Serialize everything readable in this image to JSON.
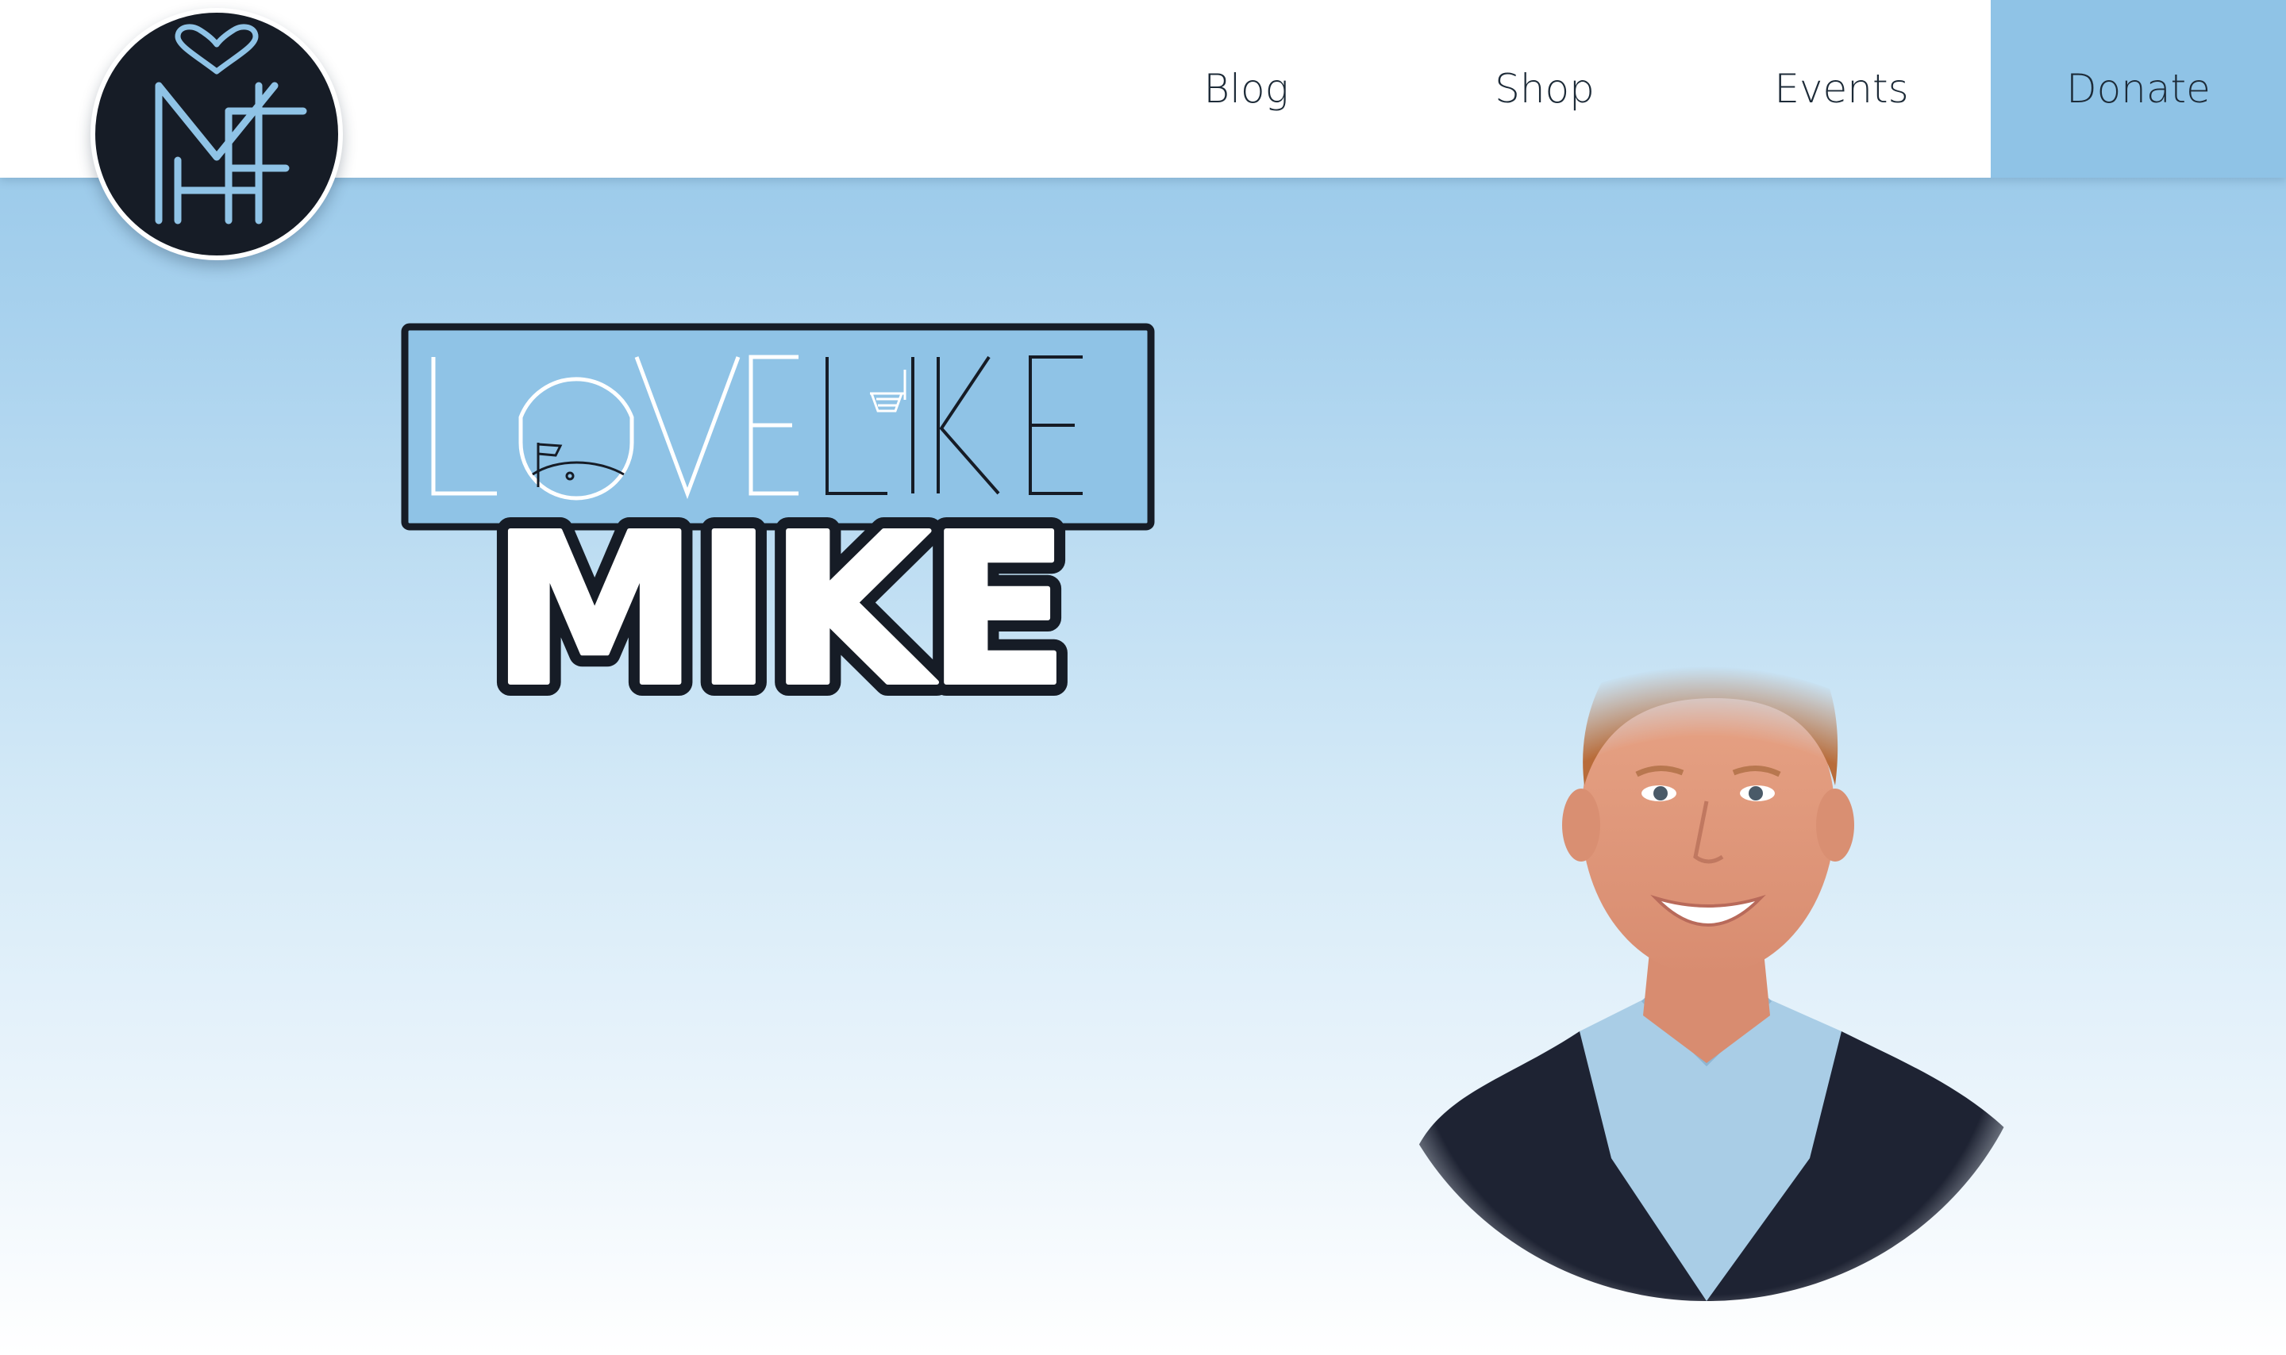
{
  "nav": {
    "items": [
      {
        "label": "Blog"
      },
      {
        "label": "Shop"
      },
      {
        "label": "Events"
      },
      {
        "label": "Donate"
      }
    ]
  },
  "logo": {
    "monogram": "MHF",
    "icon": "heart-monogram-icon"
  },
  "hero": {
    "logo_line1": "LOVELIKE",
    "logo_line2": "MIKE",
    "portrait_icon": "person-portrait-icon"
  },
  "colors": {
    "accent": "#8fc3e6",
    "navy": "#161c26",
    "text": "#1d2b38",
    "white": "#ffffff"
  }
}
